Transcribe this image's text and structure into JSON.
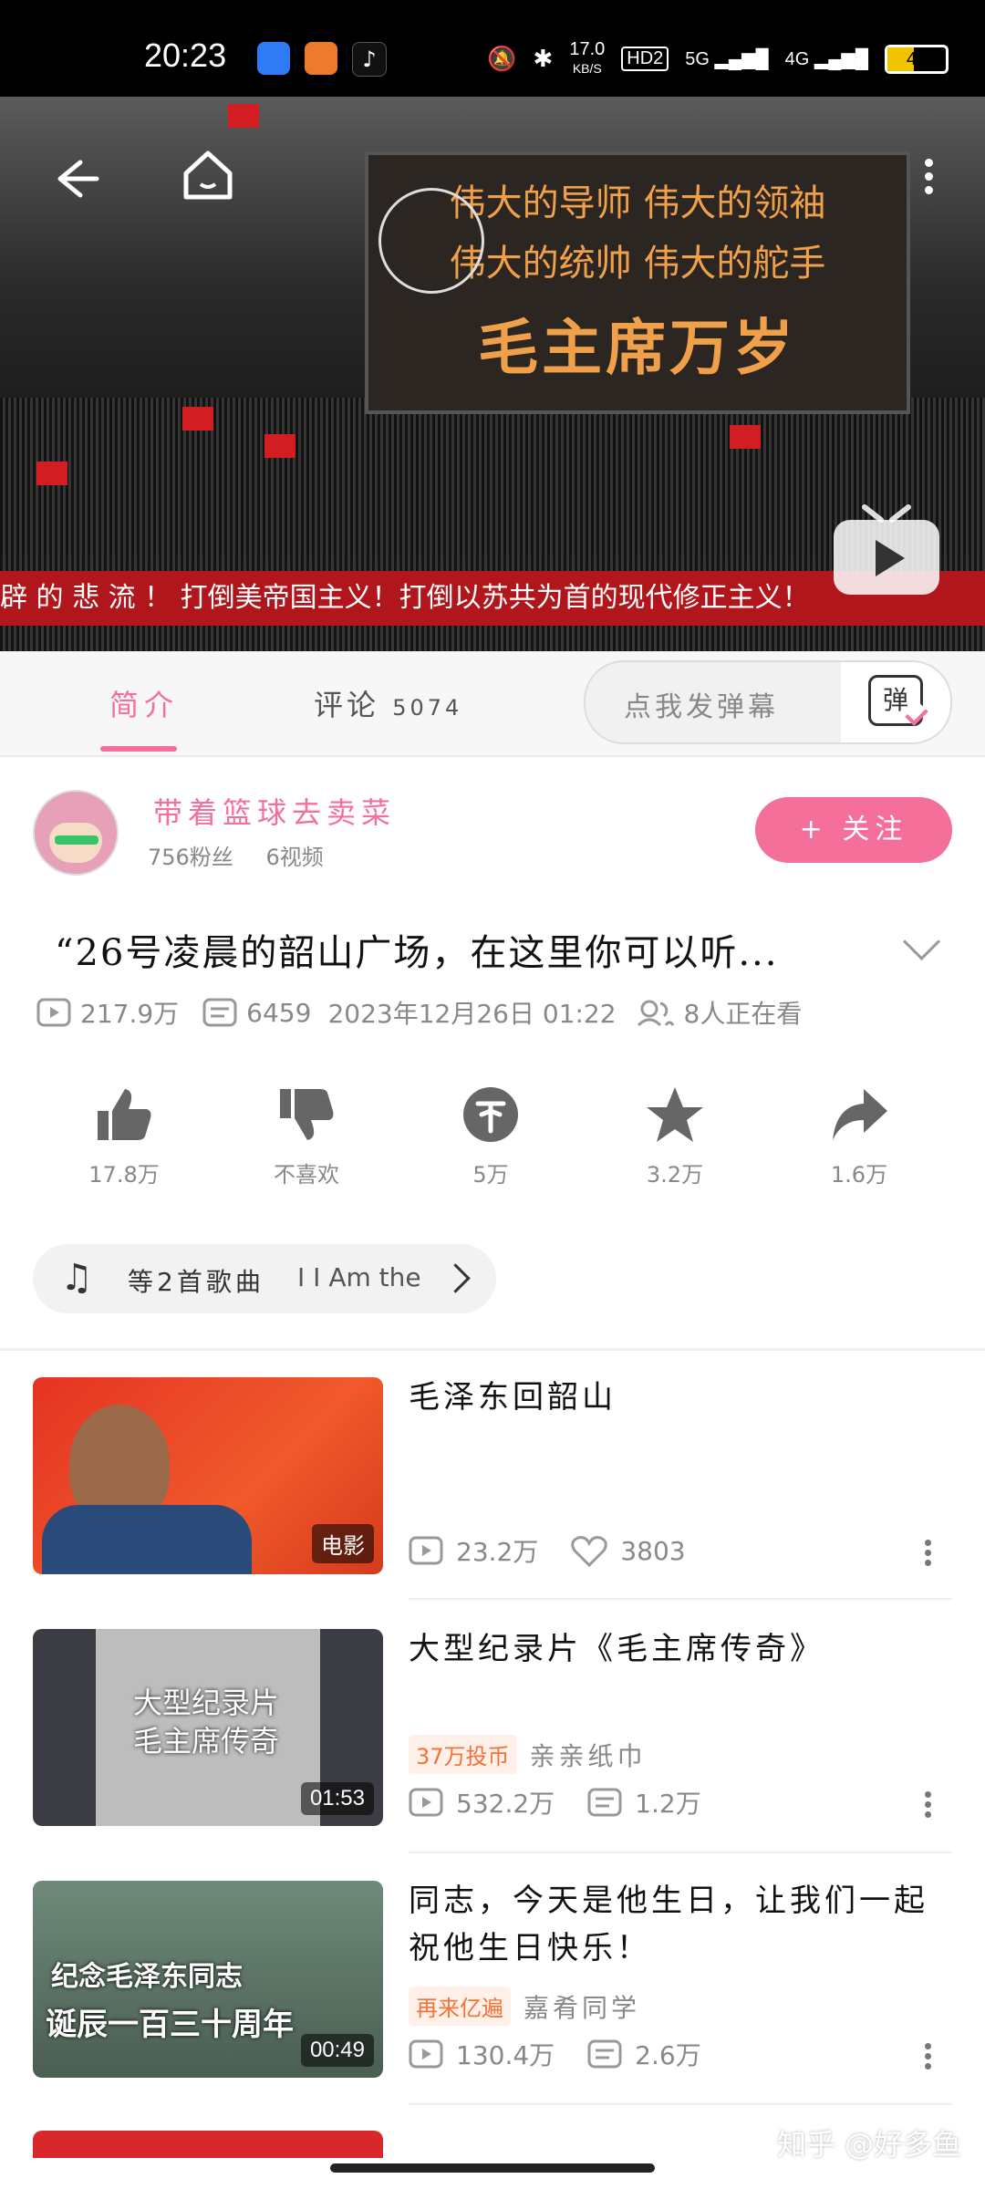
{
  "status_bar": {
    "time": "20:23",
    "net_speed": "17.0",
    "net_unit": "KB/S",
    "hd": "HD2",
    "sig1": "5G",
    "sig2": "4G",
    "battery": "46"
  },
  "video": {
    "board_line1": "伟大的导师  伟大的领袖",
    "board_line2": "伟大的统帅  伟大的舵手",
    "board_line3": "毛主席万岁",
    "banner_text": "辟 的 悲 流 ！        打倒美帝国主义！打倒以苏共为首的现代修正主义！"
  },
  "tabs": {
    "intro": "简介",
    "comments_label": "评论",
    "comments_count": "5074",
    "danmu_placeholder": "点我发弹幕",
    "danmu_button": "弹"
  },
  "uploader": {
    "name": "带着篮球去卖菜",
    "fans": "756粉丝",
    "videos": "6视频",
    "follow_label": "+ 关注"
  },
  "video_info": {
    "title": "“26号凌晨的韶山广场，在这里你可以听...",
    "views": "217.9万",
    "danmaku": "6459",
    "date": "2023年12月26日 01:22",
    "watching": "8人正在看"
  },
  "actions": [
    {
      "label": "17.8万",
      "icon": "thumbs-up-icon"
    },
    {
      "label": "不喜欢",
      "icon": "thumbs-down-icon"
    },
    {
      "label": "5万",
      "icon": "coin-icon"
    },
    {
      "label": "3.2万",
      "icon": "star-icon"
    },
    {
      "label": "1.6万",
      "icon": "share-icon"
    }
  ],
  "music": {
    "text": "等2首歌曲",
    "song": "I Am the"
  },
  "related": [
    {
      "title": "毛泽东回韶山",
      "badge": "电影",
      "views": "23.2万",
      "likes": "3803"
    },
    {
      "title": "大型纪录片《毛主席传奇》",
      "badge": "01:53",
      "thumb_line1": "大型纪录片",
      "thumb_line2": "毛主席传奇",
      "tag": "37万投币",
      "uploader": "亲亲纸巾",
      "views": "532.2万",
      "danmaku": "1.2万"
    },
    {
      "title": "同志，今天是他生日，让我们一起祝他生日快乐！",
      "badge": "00:49",
      "thumb_line1": "纪念毛泽东同志",
      "thumb_line2": "诞辰一百三十周年",
      "tag": "再来亿遍",
      "uploader": "嘉肴同学",
      "views": "130.4万",
      "danmaku": "2.6万"
    }
  ],
  "watermark": "知乎 @好多鱼",
  "colors": {
    "accent": "#f4709a",
    "orange_tag": "#f57235"
  }
}
